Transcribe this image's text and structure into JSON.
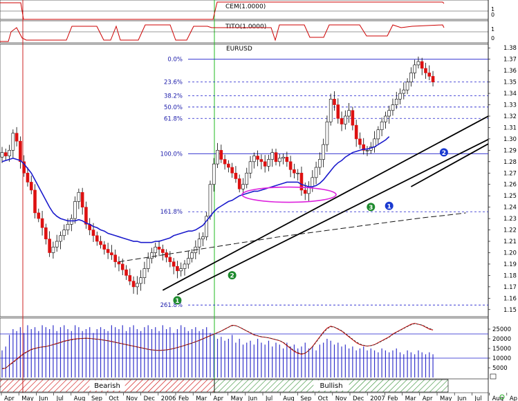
{
  "chart_data": {
    "type": "candlestick",
    "symbol": "EURUSD",
    "indicators": [
      {
        "label": "CEM(1.0000)",
        "ticks": [
          "1",
          "0"
        ]
      },
      {
        "label": "TITO(1.0000)",
        "ticks": [
          "1",
          "0"
        ]
      }
    ],
    "price_axis": {
      "ylim": [
        1.145,
        1.385
      ],
      "ticks": [
        "1.38",
        "1.37",
        "1.36",
        "1.35",
        "1.34",
        "1.33",
        "1.32",
        "1.31",
        "1.30",
        "1.29",
        "1.28",
        "1.27",
        "1.26",
        "1.25",
        "1.24",
        "1.23",
        "1.22",
        "1.21",
        "1.20",
        "1.19",
        "1.18",
        "1.17",
        "1.16",
        "1.15"
      ]
    },
    "fibonacci": [
      {
        "label": "0.0%",
        "value": 1.37
      },
      {
        "label": "23.6%",
        "value": 1.35
      },
      {
        "label": "38.2%",
        "value": 1.338
      },
      {
        "label": "50.0%",
        "value": 1.328
      },
      {
        "label": "61.8%",
        "value": 1.318
      },
      {
        "label": "100.0%",
        "value": 1.287
      },
      {
        "label": "161.8%",
        "value": 1.236
      },
      {
        "label": "261.8%",
        "value": 1.154
      }
    ],
    "markers": [
      {
        "label": "1",
        "color": "green",
        "x": 48,
        "price": 1.163
      },
      {
        "label": "2",
        "color": "green",
        "x": 63,
        "price": 1.185
      },
      {
        "label": "3",
        "color": "green",
        "x": 101,
        "price": 1.245
      },
      {
        "label": "1",
        "color": "blue",
        "x": 106,
        "price": 1.246
      },
      {
        "label": "2",
        "color": "blue",
        "x": 121,
        "price": 1.293
      }
    ],
    "trendlines": [
      {
        "from": [
          44,
          1.167
        ],
        "to": [
          153,
          1.354
        ]
      },
      {
        "from": [
          112,
          1.258
        ],
        "to": [
          153,
          1.331
        ]
      },
      {
        "from": [
          48,
          1.163
        ],
        "to": [
          101,
          1.248
        ]
      }
    ],
    "closes": [
      1.288,
      1.285,
      1.29,
      1.305,
      1.298,
      1.28,
      1.27,
      1.262,
      1.255,
      1.235,
      1.23,
      1.222,
      1.212,
      1.2,
      1.205,
      1.21,
      1.215,
      1.22,
      1.225,
      1.23,
      1.245,
      1.253,
      1.24,
      1.225,
      1.22,
      1.215,
      1.21,
      1.207,
      1.203,
      1.2,
      1.198,
      1.192,
      1.19,
      1.185,
      1.18,
      1.175,
      1.17,
      1.173,
      1.178,
      1.186,
      1.195,
      1.2,
      1.205,
      1.203,
      1.2,
      1.196,
      1.192,
      1.188,
      1.184,
      1.186,
      1.19,
      1.195,
      1.2,
      1.205,
      1.212,
      1.214,
      1.232,
      1.26,
      1.278,
      1.29,
      1.282,
      1.278,
      1.275,
      1.27,
      1.265,
      1.256,
      1.26,
      1.27,
      1.28,
      1.285,
      1.282,
      1.28,
      1.276,
      1.282,
      1.288,
      1.28,
      1.283,
      1.284,
      1.28,
      1.273,
      1.27,
      1.27,
      1.255,
      1.252,
      1.258,
      1.266,
      1.275,
      1.282,
      1.295,
      1.315,
      1.335,
      1.33,
      1.318,
      1.313,
      1.32,
      1.325,
      1.312,
      1.3,
      1.295,
      1.29,
      1.29,
      1.293,
      1.3,
      1.308,
      1.315,
      1.32,
      1.325,
      1.33,
      1.335,
      1.34,
      1.343,
      1.35,
      1.358,
      1.365,
      1.368,
      1.362,
      1.358,
      1.355,
      1.35
    ],
    "ma_fast": [
      1.28,
      1.281,
      1.282,
      1.283,
      1.282,
      1.281,
      1.278,
      1.274,
      1.27,
      1.264,
      1.258,
      1.252,
      1.246,
      1.24,
      1.235,
      1.232,
      1.23,
      1.229,
      1.228,
      1.228,
      1.228,
      1.229,
      1.228,
      1.226,
      1.225,
      1.223,
      1.222,
      1.22,
      1.219,
      1.217,
      1.216,
      1.215,
      1.214,
      1.213,
      1.212,
      1.211,
      1.21,
      1.21,
      1.209,
      1.209,
      1.209,
      1.209,
      1.21,
      1.21,
      1.211,
      1.212,
      1.213,
      1.215,
      1.216,
      1.217,
      1.218,
      1.219,
      1.219,
      1.22,
      1.222,
      1.224,
      1.228,
      1.232,
      1.236,
      1.239,
      1.241,
      1.243,
      1.245,
      1.246,
      1.248,
      1.25,
      1.251,
      1.252,
      1.253,
      1.254,
      1.254,
      1.255,
      1.256,
      1.257,
      1.258,
      1.259,
      1.26,
      1.261,
      1.262,
      1.262,
      1.262,
      1.262,
      1.26,
      1.259,
      1.258,
      1.258,
      1.259,
      1.261,
      1.264,
      1.268,
      1.272,
      1.276,
      1.279,
      1.281,
      1.284,
      1.286,
      1.288,
      1.289,
      1.29,
      1.291,
      1.291,
      1.292,
      1.293,
      1.295,
      1.297,
      1.299,
      1.302
    ],
    "ma_slow": [
      [
        32,
        1.192
      ],
      [
        40,
        1.196
      ],
      [
        52,
        1.202
      ],
      [
        64,
        1.208
      ],
      [
        76,
        1.214
      ],
      [
        90,
        1.22
      ],
      [
        104,
        1.226
      ],
      [
        116,
        1.231
      ],
      [
        122,
        1.233
      ],
      [
        127,
        1.235
      ]
    ],
    "volume_axis": {
      "ticks": [
        "25000",
        "20000",
        "15000",
        "10000",
        "5000"
      ]
    },
    "volume": [
      14000,
      16000,
      22000,
      25000,
      24000,
      26000,
      23000,
      27000,
      25000,
      26000,
      24000,
      27000,
      26000,
      25000,
      27000,
      24000,
      26000,
      27000,
      25000,
      24000,
      27000,
      26000,
      24000,
      25000,
      26000,
      23000,
      25000,
      26000,
      25000,
      24000,
      27000,
      26000,
      25000,
      27000,
      24000,
      26000,
      27000,
      25000,
      24000,
      26000,
      27000,
      25000,
      26000,
      24000,
      27000,
      25000,
      26000,
      23000,
      25000,
      27000,
      26000,
      24000,
      25000,
      26000,
      24000,
      25000,
      26000,
      23000,
      22000,
      20000,
      21000,
      19000,
      20000,
      22000,
      18000,
      20000,
      17000,
      18000,
      19000,
      17000,
      20000,
      18000,
      17000,
      19000,
      16000,
      18000,
      17000,
      15000,
      18000,
      16000,
      17000,
      15000,
      16000,
      18000,
      15000,
      16000,
      14000,
      17000,
      18000,
      20000,
      19000,
      17000,
      18000,
      16000,
      17000,
      15000,
      16000,
      14000,
      15000,
      16000,
      14000,
      15000,
      14000,
      13000,
      15000,
      14000,
      13000,
      14000,
      15000,
      13000,
      12000,
      14000,
      13000,
      12000,
      14000,
      13000,
      12000,
      13000,
      12000
    ],
    "osc_value": [
      4500,
      4800,
      6500,
      8000,
      9500,
      11000,
      12500,
      13500,
      14500,
      15000,
      15500,
      15800,
      16000,
      16500,
      17000,
      17600,
      18200,
      18800,
      19200,
      19600,
      19900,
      20100,
      20200,
      20300,
      20200,
      20000,
      19800,
      19600,
      19300,
      19000,
      18600,
      18200,
      17800,
      17400,
      17000,
      16600,
      16200,
      15800,
      15400,
      15000,
      14600,
      14300,
      14100,
      14000,
      14100,
      14300,
      14600,
      15000,
      15500,
      16000,
      16600,
      17200,
      17800,
      18500,
      19200,
      20000,
      20800,
      21600,
      22400,
      23200,
      24000,
      25000,
      26000,
      27000,
      26800,
      26000,
      25000,
      24000,
      23000,
      22000,
      21500,
      21000,
      20800,
      20500,
      20000,
      19500,
      19000,
      18000,
      16500,
      15000,
      13500,
      12500,
      12000,
      12500,
      14000,
      16000,
      18500,
      21000,
      23500,
      25500,
      26500,
      26000,
      25000,
      24000,
      22500,
      21000,
      19500,
      18000,
      17000,
      16500,
      16200,
      16500,
      17000,
      18000,
      19000,
      20000,
      21000,
      22500,
      23500,
      24500,
      25500,
      26500,
      27500,
      28000,
      27500,
      27000,
      26000,
      25000,
      24500
    ],
    "osc_signal": [
      4700,
      5000,
      6300,
      7600,
      9200,
      10700,
      12200,
      13300,
      14300,
      14900,
      15400,
      15700,
      15900,
      16400,
      16900,
      17400,
      18000,
      18600,
      19000,
      19400,
      19700,
      19900,
      20100,
      20200,
      20100,
      19900,
      19700,
      19500,
      19200,
      18900,
      18500,
      18100,
      17700,
      17300,
      16900,
      16500,
      16100,
      15700,
      15300,
      14900,
      14500,
      14200,
      14000,
      13900,
      14000,
      14200,
      14500,
      14900,
      15400,
      15900,
      16500,
      17100,
      17700,
      18400,
      19100,
      19900,
      20700,
      21500,
      22300,
      23100,
      23900,
      24900,
      25900,
      26800,
      26700,
      26000,
      25100,
      24100,
      23200,
      22200,
      21600,
      21100,
      20800,
      20500,
      20100,
      19600,
      19100,
      18200,
      16800,
      15300,
      13900,
      12900,
      12300,
      12600,
      13900,
      15700,
      18200,
      20700,
      23100,
      25100,
      26200,
      26000,
      25200,
      24200,
      22800,
      21300,
      19800,
      18400,
      17300,
      16700,
      16300,
      16400,
      16900,
      17800,
      18800,
      19800,
      20800,
      22200,
      23300,
      24300,
      25300,
      26300,
      27200,
      27800,
      27500,
      27100,
      26300,
      25300,
      24800
    ],
    "time_axis": [
      "Apr",
      "May",
      "Jun",
      "Jul",
      "Aug",
      "Sep",
      "Oct",
      "Nov",
      "Dec",
      "2006",
      "Feb",
      "Mar",
      "Apr",
      "May",
      "Jun",
      "Jul",
      "Aug",
      "Sep",
      "Oct",
      "Nov",
      "Dec",
      "2007",
      "Feb",
      "Mar",
      "Apr",
      "May",
      "Jun",
      "Jul",
      "Aug",
      "Ap"
    ],
    "phases": [
      {
        "label": "Bearish",
        "color": "#cc0000",
        "from": 0,
        "to": 60
      },
      {
        "label": "Bullish",
        "color": "#2e8b2e",
        "from": 60,
        "to": 128
      }
    ]
  }
}
